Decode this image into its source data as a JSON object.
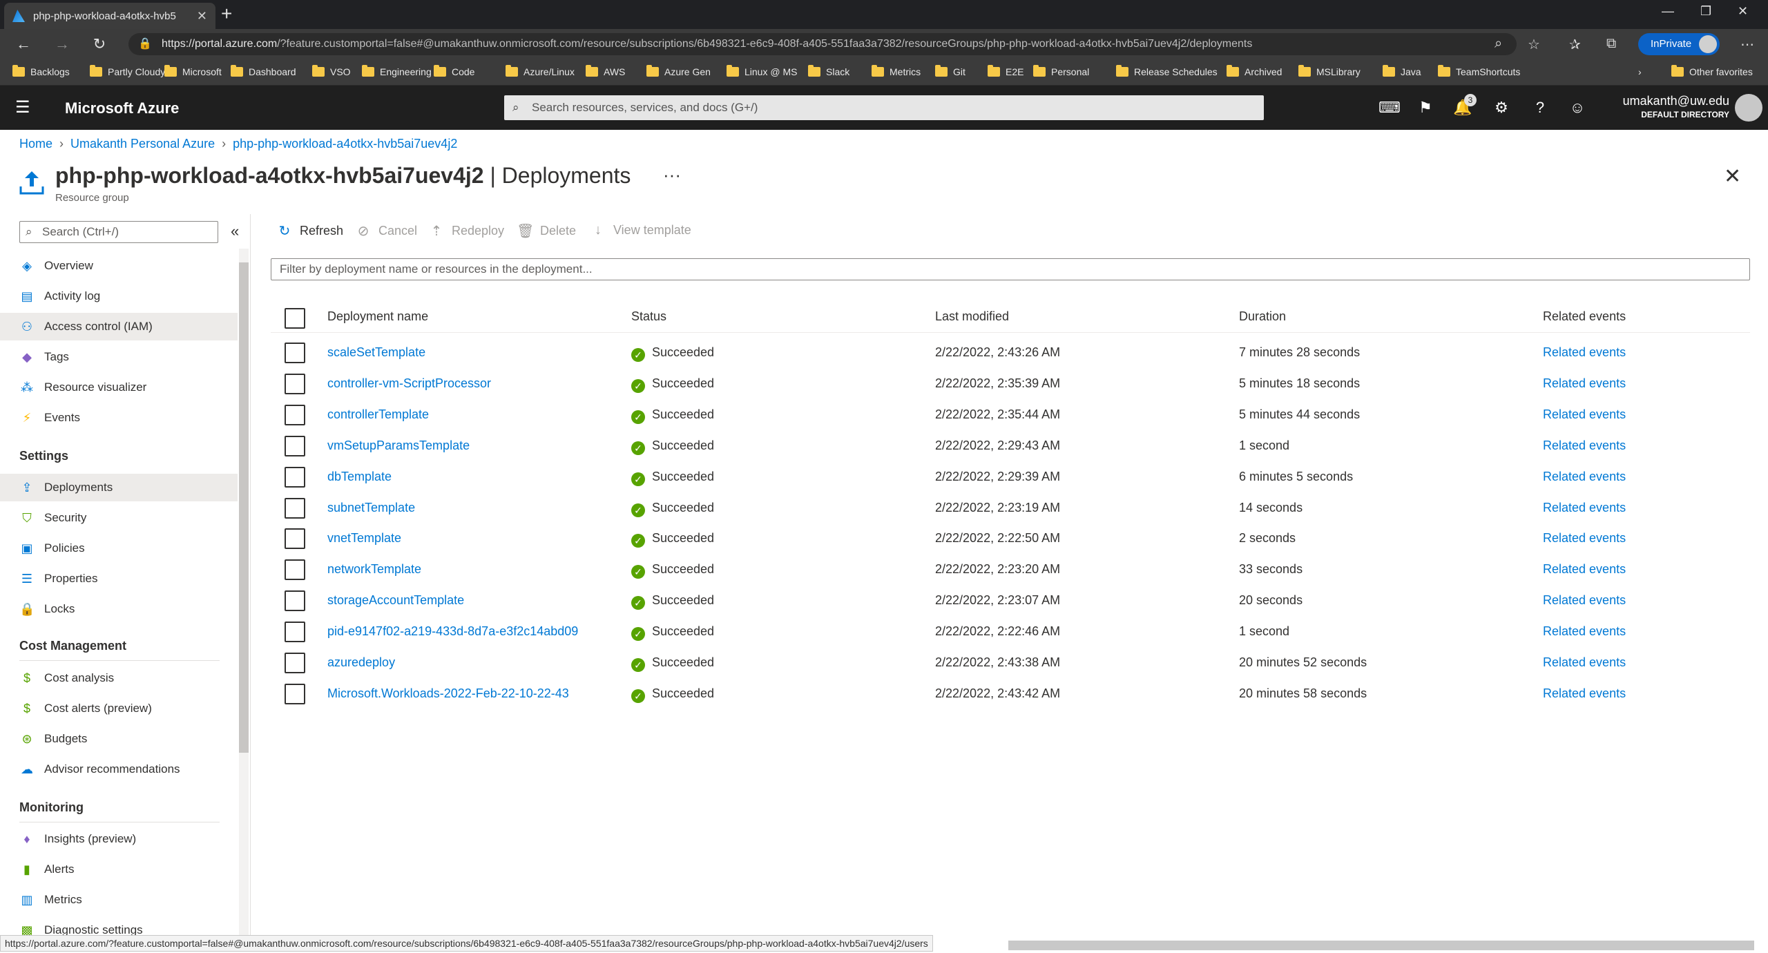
{
  "browser": {
    "tab_title": "php-php-workload-a4otkx-hvb5",
    "url_host": "https://portal.azure.com",
    "url_rest": "/?feature.customportal=false#@umakanthuw.onmicrosoft.com/resource/subscriptions/6b498321-e6c9-408f-a405-551faa3a7382/resourceGroups/php-php-workload-a4otkx-hvb5ai7uev4j2/deployments",
    "inprivate_label": "InPrivate",
    "favorites": [
      "Backlogs",
      "Partly Cloudy",
      "Microsoft",
      "Dashboard",
      "VSO",
      "Engineering",
      "Code",
      "Azure/Linux",
      "AWS",
      "Azure Gen",
      "Linux @ MS",
      "Slack",
      "Metrics",
      "Git",
      "E2E",
      "Personal",
      "Release Schedules",
      "Archived",
      "MSLibrary",
      "Java",
      "TeamShortcuts"
    ],
    "other_favorites": "Other favorites",
    "status_url": "https://portal.azure.com/?feature.customportal=false#@umakanthuw.onmicrosoft.com/resource/subscriptions/6b498321-e6c9-408f-a405-551faa3a7382/resourceGroups/php-php-workload-a4otkx-hvb5ai7uev4j2/users"
  },
  "header": {
    "brand": "Microsoft Azure",
    "search_placeholder": "Search resources, services, and docs (G+/)",
    "notification_count": "3",
    "user_email": "umakanth@uw.edu",
    "user_directory": "DEFAULT DIRECTORY"
  },
  "breadcrumb": [
    "Home",
    "Umakanth Personal Azure",
    "php-php-workload-a4otkx-hvb5ai7uev4j2"
  ],
  "page": {
    "resource_name": "php-php-workload-a4otkx-hvb5ai7uev4j2",
    "blade_name": "| Deployments",
    "subtitle": "Resource group"
  },
  "sidebar": {
    "search_placeholder": "Search (Ctrl+/)",
    "items_top": [
      {
        "label": "Overview",
        "icon": "overview-icon"
      },
      {
        "label": "Activity log",
        "icon": "activity-log-icon"
      },
      {
        "label": "Access control (IAM)",
        "icon": "iam-icon"
      },
      {
        "label": "Tags",
        "icon": "tag-icon"
      },
      {
        "label": "Resource visualizer",
        "icon": "visualizer-icon"
      },
      {
        "label": "Events",
        "icon": "bolt-icon"
      }
    ],
    "settings_header": "Settings",
    "settings_items": [
      {
        "label": "Deployments",
        "icon": "deploy-icon"
      },
      {
        "label": "Security",
        "icon": "shield-icon"
      },
      {
        "label": "Policies",
        "icon": "policy-icon"
      },
      {
        "label": "Properties",
        "icon": "properties-icon"
      },
      {
        "label": "Locks",
        "icon": "lock-icon"
      }
    ],
    "cost_header": "Cost Management",
    "cost_items": [
      {
        "label": "Cost analysis",
        "icon": "cost-analysis-icon"
      },
      {
        "label": "Cost alerts (preview)",
        "icon": "cost-alert-icon"
      },
      {
        "label": "Budgets",
        "icon": "budget-icon"
      },
      {
        "label": "Advisor recommendations",
        "icon": "advisor-icon"
      }
    ],
    "monitoring_header": "Monitoring",
    "monitoring_items": [
      {
        "label": "Insights (preview)",
        "icon": "insights-icon"
      },
      {
        "label": "Alerts",
        "icon": "alerts-icon"
      },
      {
        "label": "Metrics",
        "icon": "metrics-icon"
      },
      {
        "label": "Diagnostic settings",
        "icon": "diagnostic-icon"
      }
    ]
  },
  "toolbar": {
    "refresh": "Refresh",
    "cancel": "Cancel",
    "redeploy": "Redeploy",
    "delete": "Delete",
    "view_template": "View template"
  },
  "filter_placeholder": "Filter by deployment name or resources in the deployment...",
  "table": {
    "columns": [
      "Deployment name",
      "Status",
      "Last modified",
      "Duration",
      "Related events"
    ],
    "rows": [
      {
        "name": "scaleSetTemplate",
        "status": "Succeeded",
        "modified": "2/22/2022, 2:43:26 AM",
        "duration": "7 minutes 28 seconds",
        "events": "Related events"
      },
      {
        "name": "controller-vm-ScriptProcessor",
        "status": "Succeeded",
        "modified": "2/22/2022, 2:35:39 AM",
        "duration": "5 minutes 18 seconds",
        "events": "Related events"
      },
      {
        "name": "controllerTemplate",
        "status": "Succeeded",
        "modified": "2/22/2022, 2:35:44 AM",
        "duration": "5 minutes 44 seconds",
        "events": "Related events"
      },
      {
        "name": "vmSetupParamsTemplate",
        "status": "Succeeded",
        "modified": "2/22/2022, 2:29:43 AM",
        "duration": "1 second",
        "events": "Related events"
      },
      {
        "name": "dbTemplate",
        "status": "Succeeded",
        "modified": "2/22/2022, 2:29:39 AM",
        "duration": "6 minutes 5 seconds",
        "events": "Related events"
      },
      {
        "name": "subnetTemplate",
        "status": "Succeeded",
        "modified": "2/22/2022, 2:23:19 AM",
        "duration": "14 seconds",
        "events": "Related events"
      },
      {
        "name": "vnetTemplate",
        "status": "Succeeded",
        "modified": "2/22/2022, 2:22:50 AM",
        "duration": "2 seconds",
        "events": "Related events"
      },
      {
        "name": "networkTemplate",
        "status": "Succeeded",
        "modified": "2/22/2022, 2:23:20 AM",
        "duration": "33 seconds",
        "events": "Related events"
      },
      {
        "name": "storageAccountTemplate",
        "status": "Succeeded",
        "modified": "2/22/2022, 2:23:07 AM",
        "duration": "20 seconds",
        "events": "Related events"
      },
      {
        "name": "pid-e9147f02-a219-433d-8d7a-e3f2c14abd09",
        "status": "Succeeded",
        "modified": "2/22/2022, 2:22:46 AM",
        "duration": "1 second",
        "events": "Related events"
      },
      {
        "name": "azuredeploy",
        "status": "Succeeded",
        "modified": "2/22/2022, 2:43:38 AM",
        "duration": "20 minutes 52 seconds",
        "events": "Related events"
      },
      {
        "name": "Microsoft.Workloads-2022-Feb-22-10-22-43",
        "status": "Succeeded",
        "modified": "2/22/2022, 2:43:42 AM",
        "duration": "20 minutes 58 seconds",
        "events": "Related events"
      }
    ]
  },
  "colors": {
    "accent": "#0078d4",
    "success": "#57a300",
    "header_bg": "#1f1f1f"
  }
}
